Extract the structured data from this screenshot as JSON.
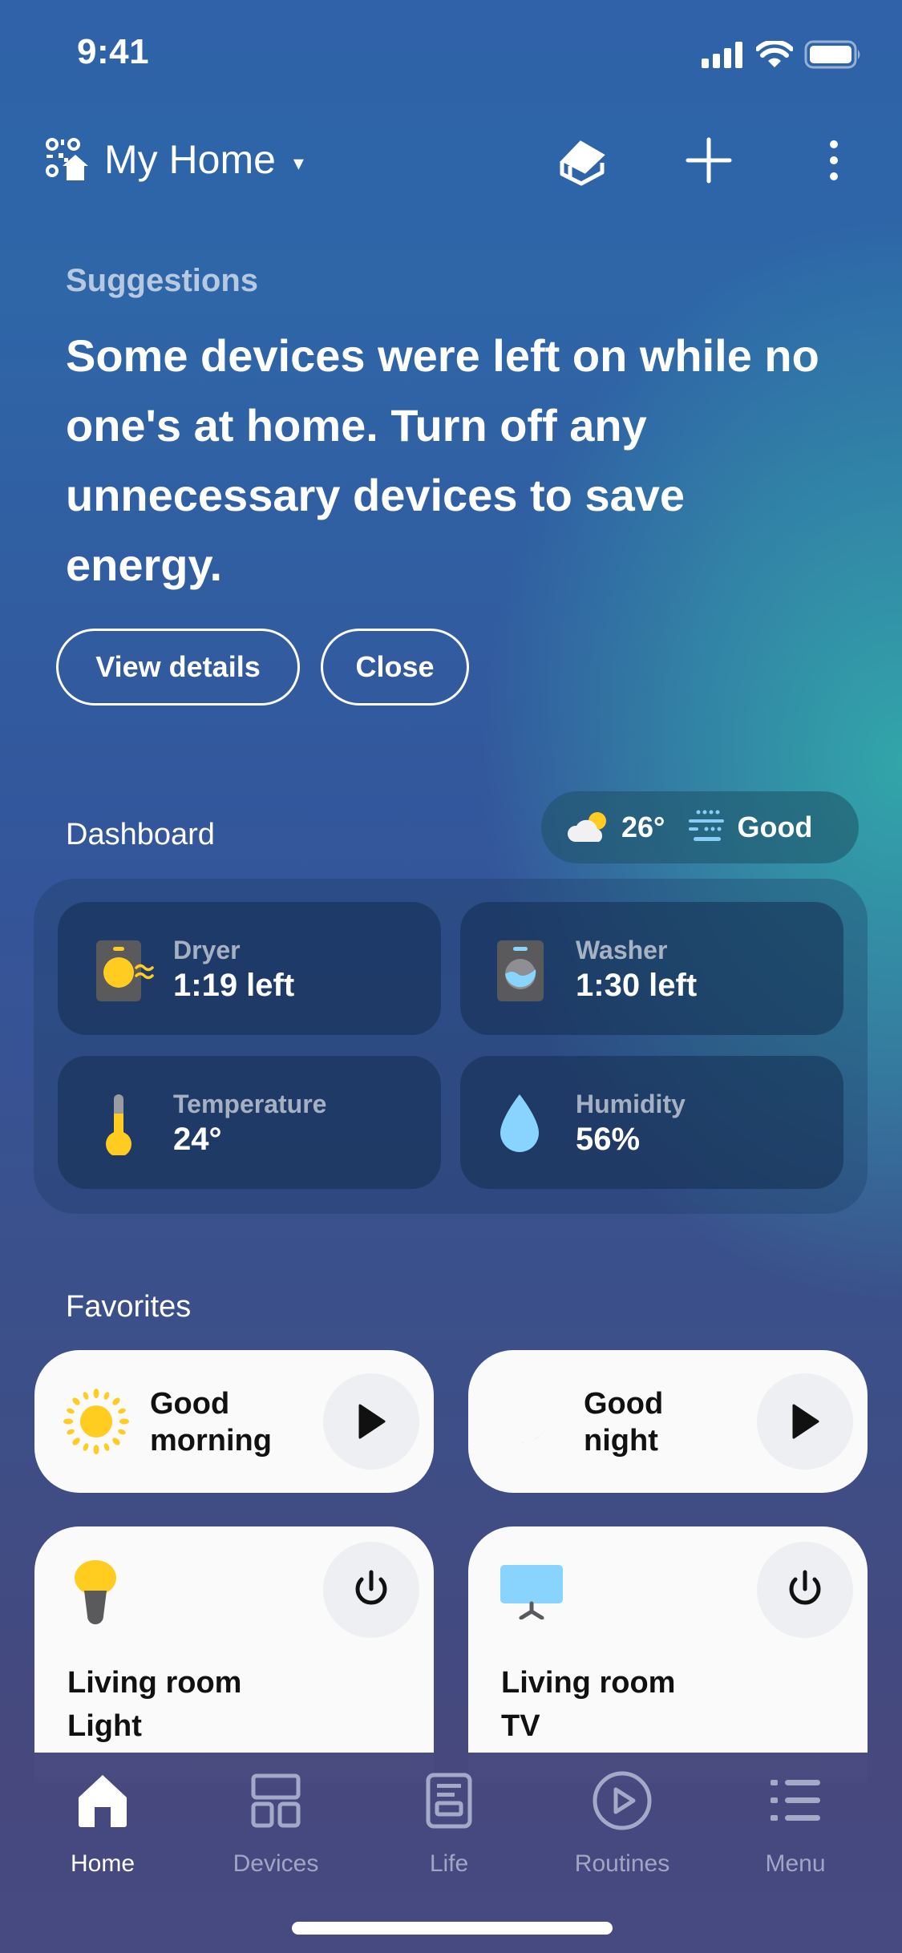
{
  "status_bar": {
    "time": "9:41",
    "icons": [
      "cellular-signal-icon",
      "wifi-icon",
      "battery-icon"
    ]
  },
  "header": {
    "home_name": "My Home",
    "caret": "▾",
    "icons": {
      "home_switcher": "qr-home-icon",
      "hub": "hub-icon",
      "add": "plus-icon",
      "more": "more-vertical-icon"
    }
  },
  "suggestions": {
    "label": "Suggestions",
    "message": "Some devices were left on while no one's at home. Turn off any unnecessary devices to save energy.",
    "buttons": {
      "view_details": "View details",
      "close": "Close"
    }
  },
  "dashboard": {
    "label": "Dashboard",
    "weather": {
      "temperature": "26°",
      "air_quality": "Good",
      "weather_icon": "partly-cloudy-icon",
      "air_icon": "air-quality-icon"
    },
    "tiles": [
      {
        "label": "Dryer",
        "value": "1:19 left",
        "icon": "dryer-icon"
      },
      {
        "label": "Washer",
        "value": "1:30 left",
        "icon": "washer-icon"
      },
      {
        "label": "Temperature",
        "value": "24°",
        "icon": "thermometer-icon"
      },
      {
        "label": "Humidity",
        "value": "56%",
        "icon": "water-drop-icon"
      }
    ]
  },
  "favorites": {
    "label": "Favorites",
    "routines": [
      {
        "line1": "Good",
        "line2": "morning",
        "icon": "sun-icon",
        "action": "play-icon"
      },
      {
        "line1": "Good",
        "line2": "night",
        "icon": "moon-icon",
        "action": "play-icon"
      }
    ],
    "devices": [
      {
        "line1": "Living room",
        "line2": "Light",
        "icon": "light-bulb-icon",
        "action": "power-icon"
      },
      {
        "line1": "Living room",
        "line2": "TV",
        "icon": "tv-icon",
        "action": "power-icon"
      }
    ]
  },
  "bottom_nav": {
    "items": [
      {
        "label": "Home",
        "icon": "home-icon",
        "active": true
      },
      {
        "label": "Devices",
        "icon": "devices-icon",
        "active": false
      },
      {
        "label": "Life",
        "icon": "life-icon",
        "active": false
      },
      {
        "label": "Routines",
        "icon": "routines-icon",
        "active": false
      },
      {
        "label": "Menu",
        "icon": "menu-icon",
        "active": false
      }
    ]
  },
  "colors": {
    "accent_yellow": "#ffcc1f",
    "accent_light_blue": "#88d4ff",
    "accent_purple": "#a89cf5",
    "card_white": "#fafafb"
  }
}
